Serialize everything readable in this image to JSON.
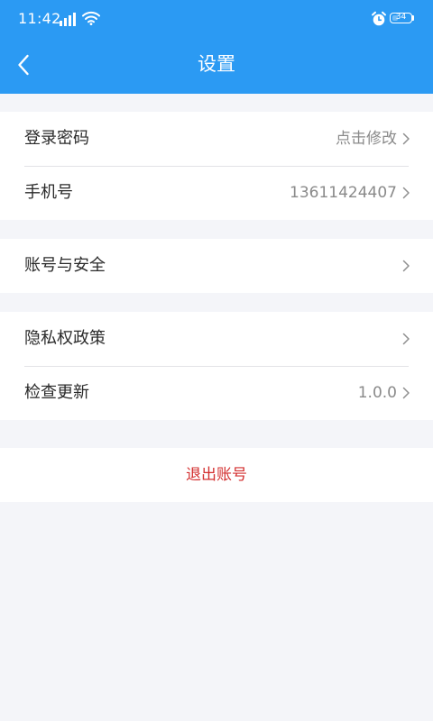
{
  "status_bar": {
    "time": "11:42",
    "battery": "34",
    "battery_level": 0.34,
    "icons": [
      "signal-icon",
      "wifi-icon",
      "alarm-icon",
      "battery-icon"
    ]
  },
  "header": {
    "title": "设置",
    "back_icon": "chevron-left-icon",
    "background_color": "#2b9af3"
  },
  "groups": [
    {
      "rows": [
        {
          "label": "登录密码",
          "value": "点击修改"
        },
        {
          "label": "手机号",
          "value": "13611424407"
        }
      ]
    },
    {
      "rows": [
        {
          "label": "账号与安全",
          "value": ""
        }
      ]
    },
    {
      "rows": [
        {
          "label": "隐私权政策",
          "value": ""
        },
        {
          "label": "检查更新",
          "value": "1.0.0"
        }
      ]
    }
  ],
  "logout": {
    "label": "退出账号",
    "color": "#d32f2f"
  }
}
